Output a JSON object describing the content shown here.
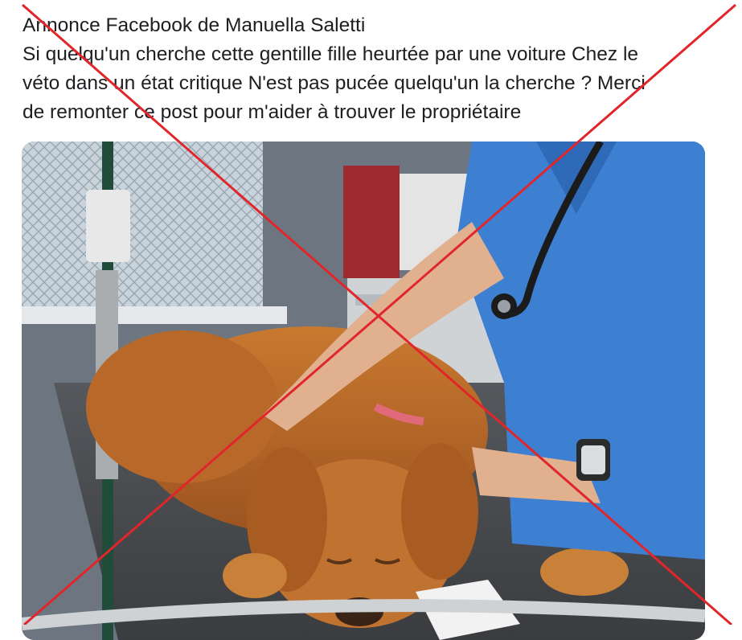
{
  "post": {
    "line1": "Annonce Facebook de Manuella Saletti",
    "line2": "Si quelqu'un cherche cette gentille fille heurtée par une voiture Chez le",
    "line3": "véto dans un état critique N'est pas pucée quelqu'un la cherche ? Merci",
    "line4": "de remonter ce post pour m'aider à trouver le propriétaire"
  },
  "colors": {
    "cross": "#e0262b",
    "scrubs": "#3d7fd1",
    "dog_fur": "#b8692a",
    "table": "#4a4c4f"
  },
  "icons": {
    "overlay": "red-cross-out-icon"
  }
}
